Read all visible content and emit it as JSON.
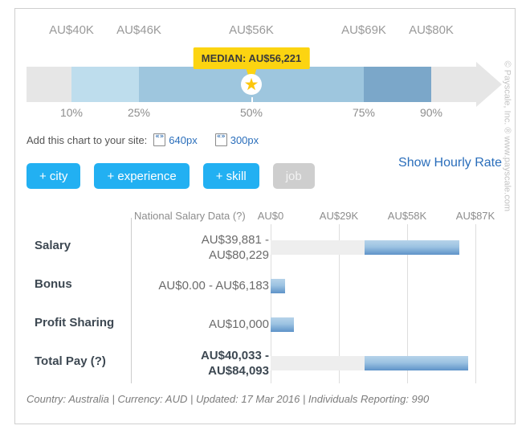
{
  "percentile_chart": {
    "value_labels": [
      {
        "text": "AU$40K",
        "pct": 10
      },
      {
        "text": "AU$46K",
        "pct": 25
      },
      {
        "text": "AU$56K",
        "pct": 50
      },
      {
        "text": "AU$69K",
        "pct": 75
      },
      {
        "text": "AU$80K",
        "pct": 90
      }
    ],
    "tick_labels": [
      {
        "text": "10%",
        "pct": 10
      },
      {
        "text": "25%",
        "pct": 25
      },
      {
        "text": "50%",
        "pct": 50
      },
      {
        "text": "75%",
        "pct": 75
      },
      {
        "text": "90%",
        "pct": 90
      }
    ],
    "median_bubble": "MEDIAN: AU$56,221",
    "star_icon": "star-icon",
    "colors": {
      "track": "#e6e6e6",
      "seg_10_25": "#bedded",
      "seg_25_75": "#9ec6de",
      "seg_75_90": "#7ba7c9",
      "bubble": "#fcd411",
      "star": "#fcc60a"
    }
  },
  "embed": {
    "label": "Add this chart to your site:",
    "links": [
      {
        "label": "640px",
        "icon": "embed-code-icon"
      },
      {
        "label": "300px",
        "icon": "embed-code-icon"
      }
    ]
  },
  "hourly_link": "Show Hourly Rate",
  "filter_buttons": [
    {
      "label": "+ city",
      "disabled": false
    },
    {
      "label": "+ experience",
      "disabled": false
    },
    {
      "label": "+ skill",
      "disabled": false
    },
    {
      "label": "job",
      "disabled": true
    }
  ],
  "salary_table": {
    "header_label": "National Salary Data (?)",
    "axis_labels": [
      "AU$0",
      "AU$29K",
      "AU$58K",
      "AU$87K"
    ],
    "rows": [
      {
        "label": "Salary",
        "value": "AU$39,881 -\nAU$80,229",
        "bold": false,
        "bar_start": 39881,
        "bar_end": 80229
      },
      {
        "label": "Bonus",
        "value": "AU$0.00 - AU$6,183",
        "bold": false,
        "bar_start": 0,
        "bar_end": 6183
      },
      {
        "label": "Profit Sharing",
        "value": "AU$10,000",
        "bold": false,
        "bar_start": 0,
        "bar_end": 10000
      },
      {
        "label": "Total Pay (?)",
        "value": "AU$40,033 -\nAU$84,093",
        "bold": true,
        "bar_start": 40033,
        "bar_end": 84093
      }
    ]
  },
  "footer": "Country: Australia | Currency: AUD | Updated: 17 Mar 2016 | Individuals Reporting: 990",
  "copyright": "© Payscale, Inc. ® www.payscale.com",
  "chart_data": {
    "type": "bar",
    "title": "National Salary Data",
    "xlabel": "",
    "ylabel": "",
    "xlim": [
      0,
      87000
    ],
    "tick_values": [
      0,
      29000,
      58000,
      87000
    ],
    "tick_labels": [
      "AU$0",
      "AU$29K",
      "AU$58K",
      "AU$87K"
    ],
    "currency": "AUD",
    "categories": [
      "Salary",
      "Bonus",
      "Profit Sharing",
      "Total Pay"
    ],
    "ranges": [
      {
        "category": "Salary",
        "low": 39881,
        "high": 80229
      },
      {
        "category": "Bonus",
        "low": 0,
        "high": 6183
      },
      {
        "category": "Profit Sharing",
        "low": 10000,
        "high": 10000
      },
      {
        "category": "Total Pay",
        "low": 40033,
        "high": 84093
      }
    ],
    "percentile_distribution": {
      "percentiles": [
        10,
        25,
        50,
        75,
        90
      ],
      "values": [
        40000,
        46000,
        56000,
        69000,
        80000
      ],
      "labels": [
        "AU$40K",
        "AU$46K",
        "AU$56K",
        "AU$69K",
        "AU$80K"
      ],
      "median": 56221
    },
    "grid": true,
    "legend": "none"
  }
}
